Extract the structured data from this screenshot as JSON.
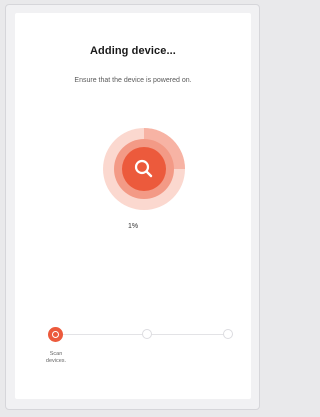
{
  "screen": {
    "title": "Adding device...",
    "subtitle": "Ensure that the device is powered on.",
    "progress_text": "1%",
    "progress_value": 0.01,
    "scan_icon": "search-icon"
  },
  "steps": [
    {
      "label_line1": "Scan",
      "label_line2": "devices.",
      "state": "active"
    },
    {
      "label_line1": "",
      "label_line2": "",
      "state": "inactive"
    },
    {
      "label_line1": "",
      "label_line2": "",
      "state": "inactive"
    }
  ],
  "colors": {
    "accent": "#ec5a3c",
    "accent_ring": "#f39a86",
    "accent_halo": "#fbd8cf"
  }
}
